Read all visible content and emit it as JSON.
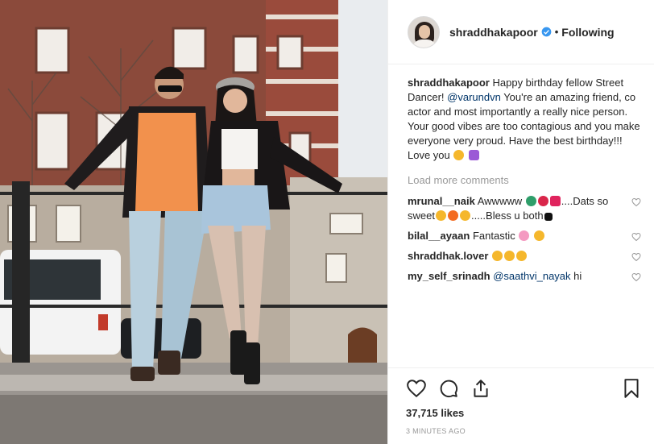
{
  "post": {
    "author": "shraddhakapoor",
    "follow_status": "Following",
    "separator": "•"
  },
  "caption": {
    "username": "shraddhakapoor",
    "text_before": "Happy birthday fellow Street Dancer! ",
    "mention": "@varundvn",
    "text_after": " You're an amazing friend, co actor and most importantly a really nice person. Your good vibes are too contagious and you make everyone very proud. Have the best birthday!!! Love you"
  },
  "load_more_label": "Load more comments",
  "comments": [
    {
      "username": "mrunal__naik",
      "text_a": "Awwwww",
      "text_b": "....Dats so sweet",
      "text_c": ".....Bless u both"
    },
    {
      "username": "bilal__ayaan",
      "text_a": "Fantastic"
    },
    {
      "username": "shraddhak.lover",
      "text_a": ""
    },
    {
      "username": "my_self_srinadh",
      "mention": "@saathvi_nayak",
      "text_a": " hi"
    }
  ],
  "likes": "37,715 likes",
  "timestamp": "3 MINUTES AGO",
  "icons": {
    "like": "heart-icon",
    "comment": "comment-icon",
    "share": "share-icon",
    "save": "bookmark-icon",
    "verified": "verified-badge-icon"
  },
  "colors": {
    "verified": "#3897f0",
    "mention": "#003569",
    "muted": "#999999",
    "text": "#262626"
  }
}
